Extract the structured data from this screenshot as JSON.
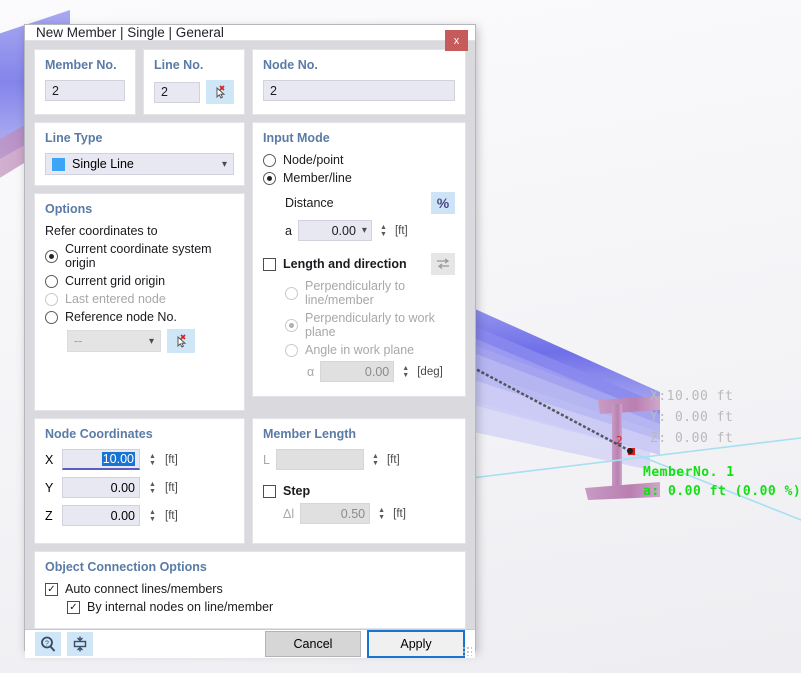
{
  "viewport": {
    "coords": [
      "X:10.00 ft",
      "Y: 0.00 ft",
      "Z: 0.00 ft"
    ],
    "node_number": "2",
    "member_label": "MemberNo. 1",
    "distance_label": "a: 0.00 ft (0.00 %)",
    "colors": {
      "beam_flange": "#6f6fe8",
      "beam_web": "#b97fb0",
      "grid_line": "#a8dff0",
      "label_green": "#12e012",
      "node_red": "#e01b1b"
    }
  },
  "dialog": {
    "title": "New Member | Single | General",
    "close_label": "x",
    "member_no": {
      "legend": "Member No.",
      "value": "2"
    },
    "line_no": {
      "legend": "Line No.",
      "value": "2",
      "pick_icon": "cursor-pick-icon"
    },
    "node_no": {
      "legend": "Node No.",
      "value": "2"
    },
    "line_type": {
      "legend": "Line Type",
      "value": "Single Line",
      "swatch_color": "#3da5f5"
    },
    "options": {
      "legend": "Options",
      "group_label": "Refer coordinates to",
      "radios": [
        {
          "label": "Current coordinate system origin",
          "selected": true,
          "disabled": false
        },
        {
          "label": "Current grid origin",
          "selected": false,
          "disabled": false
        },
        {
          "label": "Last entered node",
          "selected": false,
          "disabled": true
        },
        {
          "label": "Reference node No.",
          "selected": false,
          "disabled": false
        }
      ],
      "reference_node_value": "--"
    },
    "input_mode": {
      "legend": "Input Mode",
      "radios": [
        {
          "label": "Node/point",
          "selected": false
        },
        {
          "label": "Member/line",
          "selected": true
        }
      ],
      "distance_label": "Distance",
      "percent_button": "%",
      "a_label": "a",
      "a_value": "0.00",
      "a_unit": "[ft]",
      "length_direction": {
        "label": "Length and direction",
        "checked": false,
        "icon": "swap-arrows-icon"
      },
      "sub_radios": [
        {
          "label": "Perpendicularly to line/member",
          "selected": false
        },
        {
          "label": "Perpendicularly to work plane",
          "selected": true
        },
        {
          "label": "Angle in work plane",
          "selected": false
        }
      ],
      "alpha_label": "α",
      "alpha_value": "0.00",
      "alpha_unit": "[deg]"
    },
    "node_coordinates": {
      "legend": "Node Coordinates",
      "rows": [
        {
          "name": "X",
          "value": "10.00",
          "unit": "[ft]",
          "focused": true
        },
        {
          "name": "Y",
          "value": "0.00",
          "unit": "[ft]",
          "focused": false
        },
        {
          "name": "Z",
          "value": "0.00",
          "unit": "[ft]",
          "focused": false
        }
      ]
    },
    "member_length": {
      "legend": "Member Length",
      "l_label": "L",
      "l_value": "",
      "l_unit": "[ft]",
      "step_label": "Step",
      "step_checked": false,
      "delta_label": "Δl",
      "delta_value": "0.50",
      "delta_unit": "[ft]"
    },
    "object_connection": {
      "legend": "Object Connection Options",
      "items": [
        {
          "label": "Auto connect lines/members",
          "checked": true
        },
        {
          "label": "By internal nodes on line/member",
          "checked": true
        }
      ]
    },
    "footer": {
      "help_icon": "help-magnifier-icon",
      "resize_icon": "collapse-expand-icon",
      "cancel_label": "Cancel",
      "apply_label": "Apply"
    }
  }
}
